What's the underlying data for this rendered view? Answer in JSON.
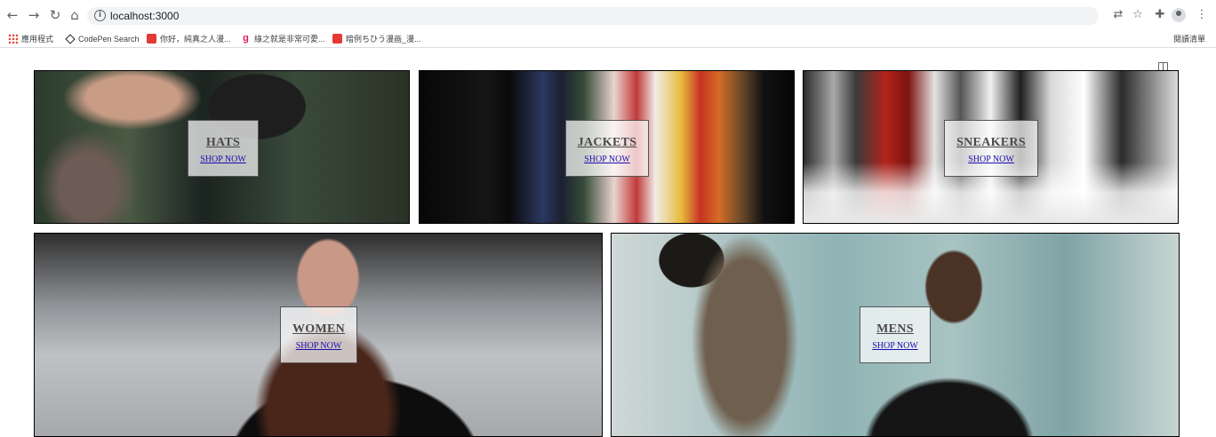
{
  "browser": {
    "url": "localhost:3000",
    "bookmarks": [
      {
        "label": "應用程式",
        "icon": "apps-grid-icon"
      },
      {
        "label": "CodePen Search",
        "icon": "codepen-icon"
      },
      {
        "label": "你好，純真之人漫...",
        "icon": "bookmark-red-icon"
      },
      {
        "label": "綠之就是非常可愛...",
        "icon": "bookmark-pink-icon"
      },
      {
        "label": "暗例ちひう漫画_漫...",
        "icon": "bookmark-red-icon"
      }
    ],
    "reading_list": "閱讀清單"
  },
  "categories": [
    {
      "title": "HATS",
      "subtitle": "SHOP NOW"
    },
    {
      "title": "JACKETS",
      "subtitle": "SHOP NOW"
    },
    {
      "title": "SNEAKERS",
      "subtitle": "SHOP NOW"
    },
    {
      "title": "WOMEN",
      "subtitle": "SHOP NOW"
    },
    {
      "title": "MENS",
      "subtitle": "SHOP NOW"
    }
  ]
}
